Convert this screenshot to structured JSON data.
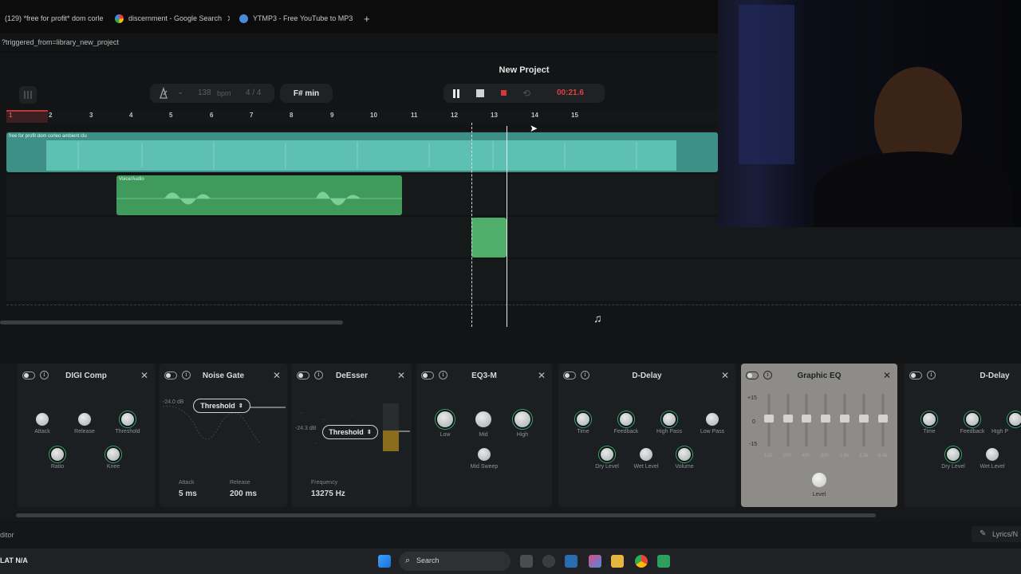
{
  "browser": {
    "tabs": [
      {
        "label": "(129) *free for profit* dom corle"
      },
      {
        "label": "discernment - Google Search"
      },
      {
        "label": "YTMP3 - Free YouTube to MP3"
      }
    ],
    "new_tab": "+",
    "url": "?triggered_from=library_new_project"
  },
  "daw": {
    "project_title": "New Project",
    "bpm": "138",
    "bpm_unit": "bpm",
    "time_sig": "4 / 4",
    "key": "F# min",
    "time": "00:21.6",
    "ruler": [
      "1",
      "2",
      "3",
      "4",
      "5",
      "6",
      "7",
      "8",
      "9",
      "10",
      "11",
      "12",
      "13",
      "14",
      "15"
    ],
    "tracks": {
      "track1_clip": "free for profit dom corleo  ambient  clu",
      "track2_clip": "Voice/Audio"
    }
  },
  "effects": [
    {
      "title": "DIGI Comp",
      "knobs": [
        "Attack",
        "Release",
        "Threshold",
        "Ratio",
        "Knee"
      ]
    },
    {
      "title": "Noise Gate",
      "threshold_db": "-24.0 dB",
      "threshold_label": "Threshold",
      "attack_label": "Attack",
      "attack_value": "5 ms",
      "release_label": "Release",
      "release_value": "200 ms"
    },
    {
      "title": "DeEsser",
      "threshold_db": "-24.3 dB",
      "threshold_label": "Threshold",
      "freq_label": "Frequency",
      "freq_value": "13275 Hz"
    },
    {
      "title": "EQ3-M",
      "knobs": [
        "Low",
        "Mid",
        "High",
        "Mid Sweep"
      ]
    },
    {
      "title": "D-Delay",
      "knobs": [
        "Time",
        "Feedback",
        "High Pass",
        "Low Pass",
        "Dry Level",
        "Wet Level",
        "Volume"
      ]
    },
    {
      "title": "Graphic EQ",
      "scale": [
        "+15",
        "0",
        "-15"
      ],
      "bands": [
        "100",
        "200",
        "400",
        "800",
        "1.6k",
        "3.2k",
        "6.4k"
      ],
      "level_label": "Level"
    },
    {
      "title": "D-Delay",
      "knobs": [
        "Time",
        "Feedback",
        "High P",
        "Dry Level",
        "Wet Level"
      ]
    }
  ],
  "status": {
    "left": "ditor",
    "right": "Lyrics/N"
  },
  "taskbar": {
    "left_text": "LAT  N/A",
    "search": "Search"
  },
  "colors": {
    "teal_clip": "#4fb3a5",
    "green_clip": "#4fae6a",
    "time_red": "#e04040"
  }
}
